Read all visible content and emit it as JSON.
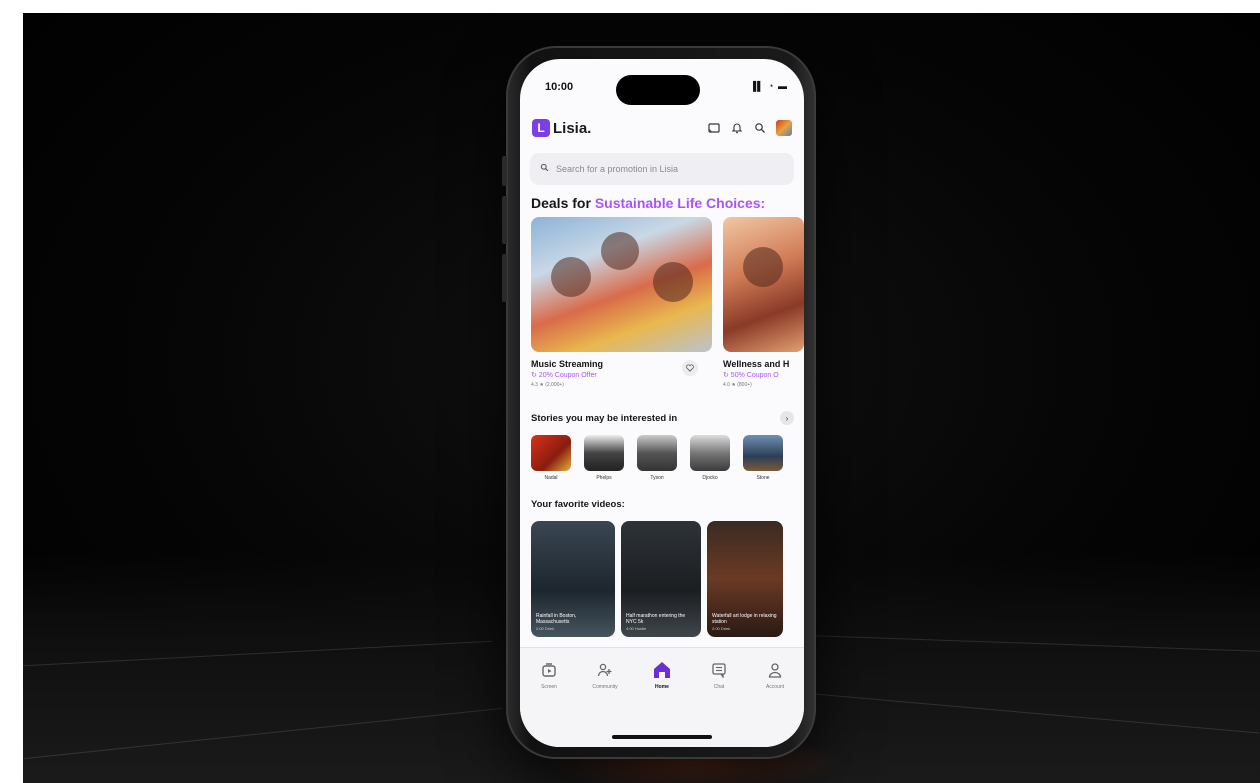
{
  "status": {
    "time": "10:00",
    "icons": "▐▌ ◔ ▬"
  },
  "brand": {
    "logo_letter": "L",
    "name": "Lisia."
  },
  "search": {
    "placeholder": "Search for a promotion in Lisia"
  },
  "deals": {
    "title_prefix": "Deals for ",
    "title_accent": "Sustainable Life Choices:",
    "accent_color": "#a855f7",
    "cards": [
      {
        "name": "Music Streaming",
        "offer": "↻ 20% Coupon Offer",
        "meta": "4.3 ★ (2,000+)"
      },
      {
        "name": "Wellness and H",
        "offer": "↻ 50% Coupon O",
        "meta": "4.0 ★ (800+)"
      }
    ]
  },
  "stories": {
    "title": "Stories you may be interested in",
    "items": [
      "Nadal",
      "Phelps",
      "Tyson",
      "Djocko",
      "Stone"
    ]
  },
  "videos": {
    "title": "Your favorite videos:",
    "items": [
      {
        "caption": "Rainfall in Boston, Massachusetts",
        "sub": "2:00 Drink"
      },
      {
        "caption": "Half marathon entering the NYC 5k",
        "sub": "4:00 Hustle"
      },
      {
        "caption": "Waterfall art lodge in relaxing station",
        "sub": "2:00 Drink"
      }
    ]
  },
  "tabs": [
    {
      "label": "Screen",
      "icon": "play-screen-icon"
    },
    {
      "label": "Community",
      "icon": "add-person-icon"
    },
    {
      "label": "Home",
      "icon": "home-icon"
    },
    {
      "label": "Chat",
      "icon": "chat-icon"
    },
    {
      "label": "Account",
      "icon": "person-icon"
    }
  ],
  "colors": {
    "brand": "#7b3fe4",
    "accent": "#a855f7",
    "active_tab": "#6b2fd6"
  }
}
